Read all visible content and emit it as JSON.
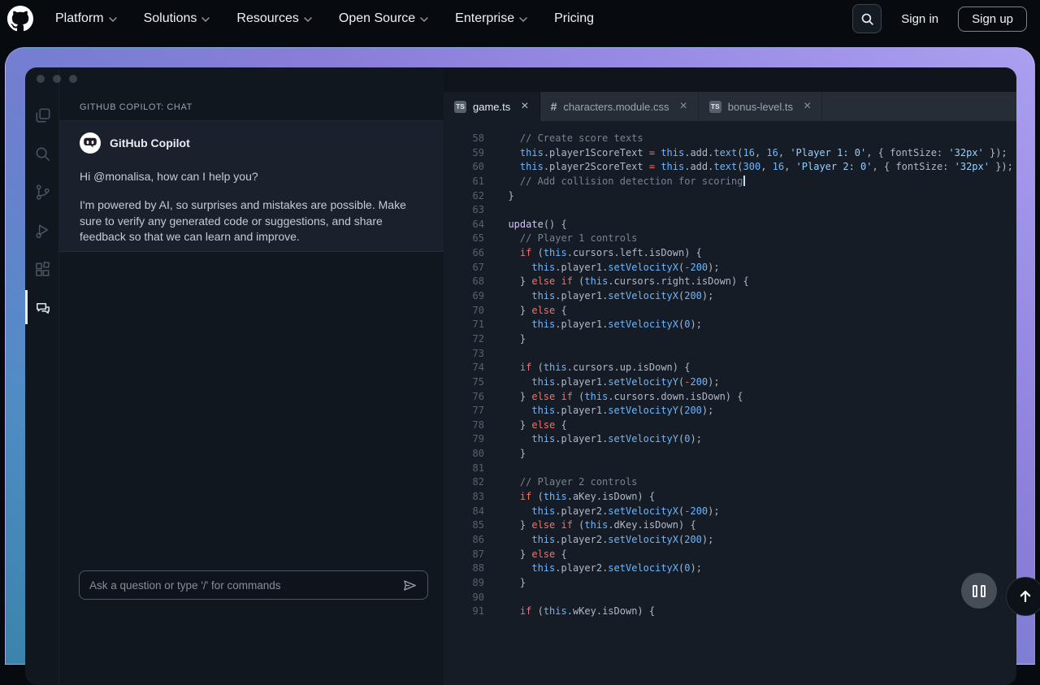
{
  "nav": {
    "items": [
      {
        "label": "Platform",
        "menu": true
      },
      {
        "label": "Solutions",
        "menu": true
      },
      {
        "label": "Resources",
        "menu": true
      },
      {
        "label": "Open Source",
        "menu": true
      },
      {
        "label": "Enterprise",
        "menu": true
      },
      {
        "label": "Pricing",
        "menu": false
      }
    ],
    "sign_in": "Sign in",
    "sign_up": "Sign up",
    "search_icon": "search-icon"
  },
  "window": {
    "activity_bar": {
      "items": [
        {
          "icon": "explorer-copy-icon",
          "active": false
        },
        {
          "icon": "search-icon",
          "active": false
        },
        {
          "icon": "source-control-icon",
          "active": false
        },
        {
          "icon": "run-debug-icon",
          "active": false
        },
        {
          "icon": "extensions-icon",
          "active": false
        },
        {
          "icon": "copilot-chat-icon",
          "active": true
        }
      ]
    },
    "chat": {
      "header": "GITHUB COPILOT: CHAT",
      "bot_name": "GitHub Copilot",
      "greeting": "Hi @monalisa, how can I help you?",
      "disclaimer": "I'm powered by AI, so surprises and mistakes are possible. Make sure to verify any generated code or suggestions, and share feedback so that we can learn and improve.",
      "input_placeholder": "Ask a question or type '/' for commands",
      "send_icon": "send-icon",
      "avatar_icon": "copilot-avatar-icon"
    },
    "tabs": [
      {
        "label": "game.ts",
        "icon": "ts",
        "active": true,
        "close_icon": "close-icon"
      },
      {
        "label": "characters.module.css",
        "icon": "hash",
        "active": false,
        "close_icon": "close-icon"
      },
      {
        "label": "bonus-level.ts",
        "icon": "ts",
        "active": false,
        "close_icon": "close-icon"
      }
    ],
    "editor": {
      "lines": [
        {
          "n": 58,
          "t": [
            [
              "cm",
              "    // Create score texts"
            ]
          ]
        },
        {
          "n": 59,
          "t": [
            [
              "pl",
              "    "
            ],
            [
              "blu",
              "this"
            ],
            [
              "pl",
              ".player1ScoreText "
            ],
            [
              "kw",
              "="
            ],
            [
              "pl",
              " "
            ],
            [
              "blu",
              "this"
            ],
            [
              "pl",
              ".add."
            ],
            [
              "blu",
              "text"
            ],
            [
              "pl",
              "("
            ],
            [
              "num",
              "16"
            ],
            [
              "pl",
              ", "
            ],
            [
              "num",
              "16"
            ],
            [
              "pl",
              ", "
            ],
            [
              "str",
              "'Player 1: 0'"
            ],
            [
              "pl",
              ", { fontSize: "
            ],
            [
              "str",
              "'32px'"
            ],
            [
              "pl",
              " });"
            ]
          ]
        },
        {
          "n": 60,
          "t": [
            [
              "pl",
              "    "
            ],
            [
              "blu",
              "this"
            ],
            [
              "pl",
              ".player2ScoreText "
            ],
            [
              "kw",
              "="
            ],
            [
              "pl",
              " "
            ],
            [
              "blu",
              "this"
            ],
            [
              "pl",
              ".add."
            ],
            [
              "blu",
              "text"
            ],
            [
              "pl",
              "("
            ],
            [
              "num",
              "300"
            ],
            [
              "pl",
              ", "
            ],
            [
              "num",
              "16"
            ],
            [
              "pl",
              ", "
            ],
            [
              "str",
              "'Player 2: 0'"
            ],
            [
              "pl",
              ", { fontSize: "
            ],
            [
              "str",
              "'32px'"
            ],
            [
              "pl",
              " });"
            ]
          ]
        },
        {
          "n": 61,
          "t": [
            [
              "cm",
              "    // Add collision detection for scoring"
            ]
          ],
          "c": true
        },
        {
          "n": 62,
          "t": [
            [
              "pl",
              "  }"
            ]
          ]
        },
        {
          "n": 63,
          "t": []
        },
        {
          "n": 64,
          "t": [
            [
              "pl",
              "  "
            ],
            [
              "fn",
              "update"
            ],
            [
              "pl",
              "() {"
            ]
          ]
        },
        {
          "n": 65,
          "t": [
            [
              "cm",
              "    // Player 1 controls"
            ]
          ]
        },
        {
          "n": 66,
          "t": [
            [
              "pl",
              "    "
            ],
            [
              "kw",
              "if"
            ],
            [
              "pl",
              " ("
            ],
            [
              "blu",
              "this"
            ],
            [
              "pl",
              ".cursors.left.isDown) {"
            ]
          ]
        },
        {
          "n": 67,
          "t": [
            [
              "pl",
              "      "
            ],
            [
              "blu",
              "this"
            ],
            [
              "pl",
              ".player1."
            ],
            [
              "blu",
              "setVelocityX"
            ],
            [
              "pl",
              "("
            ],
            [
              "kw",
              "-"
            ],
            [
              "num",
              "200"
            ],
            [
              "pl",
              ");"
            ]
          ]
        },
        {
          "n": 68,
          "t": [
            [
              "pl",
              "    } "
            ],
            [
              "kw",
              "else"
            ],
            [
              "pl",
              " "
            ],
            [
              "kw",
              "if"
            ],
            [
              "pl",
              " ("
            ],
            [
              "blu",
              "this"
            ],
            [
              "pl",
              ".cursors.right.isDown) {"
            ]
          ]
        },
        {
          "n": 69,
          "t": [
            [
              "pl",
              "      "
            ],
            [
              "blu",
              "this"
            ],
            [
              "pl",
              ".player1."
            ],
            [
              "blu",
              "setVelocityX"
            ],
            [
              "pl",
              "("
            ],
            [
              "num",
              "200"
            ],
            [
              "pl",
              ");"
            ]
          ]
        },
        {
          "n": 70,
          "t": [
            [
              "pl",
              "    } "
            ],
            [
              "kw",
              "else"
            ],
            [
              "pl",
              " {"
            ]
          ]
        },
        {
          "n": 71,
          "t": [
            [
              "pl",
              "      "
            ],
            [
              "blu",
              "this"
            ],
            [
              "pl",
              ".player1."
            ],
            [
              "blu",
              "setVelocityX"
            ],
            [
              "pl",
              "("
            ],
            [
              "num",
              "0"
            ],
            [
              "pl",
              ");"
            ]
          ]
        },
        {
          "n": 72,
          "t": [
            [
              "pl",
              "    }"
            ]
          ]
        },
        {
          "n": 73,
          "t": []
        },
        {
          "n": 74,
          "t": [
            [
              "pl",
              "    "
            ],
            [
              "kw",
              "if"
            ],
            [
              "pl",
              " ("
            ],
            [
              "blu",
              "this"
            ],
            [
              "pl",
              ".cursors.up.isDown) {"
            ]
          ]
        },
        {
          "n": 75,
          "t": [
            [
              "pl",
              "      "
            ],
            [
              "blu",
              "this"
            ],
            [
              "pl",
              ".player1."
            ],
            [
              "blu",
              "setVelocityY"
            ],
            [
              "pl",
              "("
            ],
            [
              "kw",
              "-"
            ],
            [
              "num",
              "200"
            ],
            [
              "pl",
              ");"
            ]
          ]
        },
        {
          "n": 76,
          "t": [
            [
              "pl",
              "    } "
            ],
            [
              "kw",
              "else"
            ],
            [
              "pl",
              " "
            ],
            [
              "kw",
              "if"
            ],
            [
              "pl",
              " ("
            ],
            [
              "blu",
              "this"
            ],
            [
              "pl",
              ".cursors.down.isDown) {"
            ]
          ]
        },
        {
          "n": 77,
          "t": [
            [
              "pl",
              "      "
            ],
            [
              "blu",
              "this"
            ],
            [
              "pl",
              ".player1."
            ],
            [
              "blu",
              "setVelocityY"
            ],
            [
              "pl",
              "("
            ],
            [
              "num",
              "200"
            ],
            [
              "pl",
              ");"
            ]
          ]
        },
        {
          "n": 78,
          "t": [
            [
              "pl",
              "    } "
            ],
            [
              "kw",
              "else"
            ],
            [
              "pl",
              " {"
            ]
          ]
        },
        {
          "n": 79,
          "t": [
            [
              "pl",
              "      "
            ],
            [
              "blu",
              "this"
            ],
            [
              "pl",
              ".player1."
            ],
            [
              "blu",
              "setVelocityY"
            ],
            [
              "pl",
              "("
            ],
            [
              "num",
              "0"
            ],
            [
              "pl",
              ");"
            ]
          ]
        },
        {
          "n": 80,
          "t": [
            [
              "pl",
              "    }"
            ]
          ]
        },
        {
          "n": 81,
          "t": []
        },
        {
          "n": 82,
          "t": [
            [
              "cm",
              "    // Player 2 controls"
            ]
          ]
        },
        {
          "n": 83,
          "t": [
            [
              "pl",
              "    "
            ],
            [
              "kw",
              "if"
            ],
            [
              "pl",
              " ("
            ],
            [
              "blu",
              "this"
            ],
            [
              "pl",
              ".aKey.isDown) {"
            ]
          ]
        },
        {
          "n": 84,
          "t": [
            [
              "pl",
              "      "
            ],
            [
              "blu",
              "this"
            ],
            [
              "pl",
              ".player2."
            ],
            [
              "blu",
              "setVelocityX"
            ],
            [
              "pl",
              "("
            ],
            [
              "kw",
              "-"
            ],
            [
              "num",
              "200"
            ],
            [
              "pl",
              ");"
            ]
          ]
        },
        {
          "n": 85,
          "t": [
            [
              "pl",
              "    } "
            ],
            [
              "kw",
              "else"
            ],
            [
              "pl",
              " "
            ],
            [
              "kw",
              "if"
            ],
            [
              "pl",
              " ("
            ],
            [
              "blu",
              "this"
            ],
            [
              "pl",
              ".dKey.isDown) {"
            ]
          ]
        },
        {
          "n": 86,
          "t": [
            [
              "pl",
              "      "
            ],
            [
              "blu",
              "this"
            ],
            [
              "pl",
              ".player2."
            ],
            [
              "blu",
              "setVelocityX"
            ],
            [
              "pl",
              "("
            ],
            [
              "num",
              "200"
            ],
            [
              "pl",
              ");"
            ]
          ]
        },
        {
          "n": 87,
          "t": [
            [
              "pl",
              "    } "
            ],
            [
              "kw",
              "else"
            ],
            [
              "pl",
              " {"
            ]
          ]
        },
        {
          "n": 88,
          "t": [
            [
              "pl",
              "      "
            ],
            [
              "blu",
              "this"
            ],
            [
              "pl",
              ".player2."
            ],
            [
              "blu",
              "setVelocityX"
            ],
            [
              "pl",
              "("
            ],
            [
              "num",
              "0"
            ],
            [
              "pl",
              ");"
            ]
          ]
        },
        {
          "n": 89,
          "t": [
            [
              "pl",
              "    }"
            ]
          ]
        },
        {
          "n": 90,
          "t": []
        },
        {
          "n": 91,
          "t": [
            [
              "pl",
              "    "
            ],
            [
              "kw",
              "if"
            ],
            [
              "pl",
              " ("
            ],
            [
              "blu",
              "this"
            ],
            [
              "pl",
              ".wKey.isDown) {"
            ]
          ]
        }
      ]
    },
    "floating": {
      "pause_icon": "pause-icon",
      "scroll_top_icon": "arrow-up-icon"
    }
  },
  "colors": {
    "page_bg": "#070a0f",
    "frame_gradient_top": "#ab9ff0",
    "frame_gradient_bottom": "#3a84ab",
    "window_bg": "#11171f",
    "editor_bg": "#151c26",
    "tabstrip_bg": "#262d36",
    "syntax_plain": "#adbac7",
    "syntax_comment": "#768390",
    "syntax_keyword": "#f47067",
    "syntax_entity": "#6cb6ff",
    "syntax_string": "#96d0ff",
    "syntax_function": "#dcbdfb"
  }
}
